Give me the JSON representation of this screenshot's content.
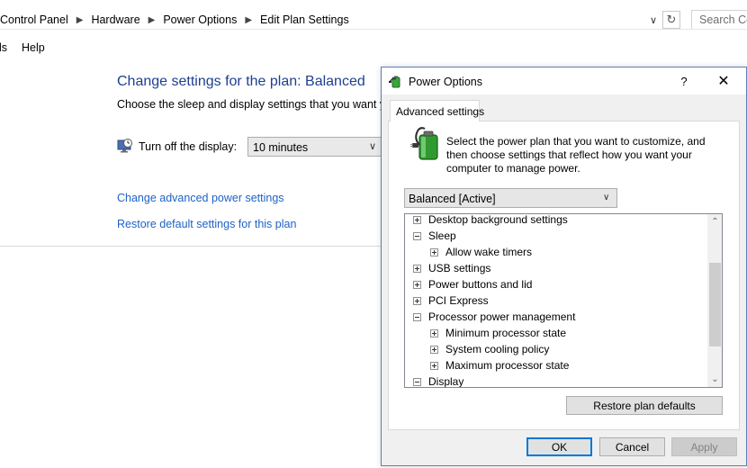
{
  "address_bar": {
    "breadcrumbs": [
      "Control Panel",
      "Hardware",
      "Power Options",
      "Edit Plan Settings"
    ],
    "search_placeholder": "Search Co"
  },
  "menu": {
    "tools_label": "ls",
    "help_label": "Help"
  },
  "plan_page": {
    "title": "Change settings for the plan: Balanced",
    "subtitle": "Choose the sleep and display settings that you want you",
    "display_label": "Turn off the display:",
    "display_value": "10 minutes",
    "advanced_link": "Change advanced power settings",
    "restore_link": "Restore default settings for this plan"
  },
  "dialog": {
    "title": "Power Options",
    "help_glyph": "?",
    "close_glyph": "✕",
    "tab_label": "Advanced settings",
    "description": "Select the power plan that you want to customize, and then choose settings that reflect how you want your computer to manage power.",
    "plan_selected": "Balanced [Active]",
    "tree_items": [
      {
        "label": "Desktop background settings",
        "level": 0,
        "state": "collapsed"
      },
      {
        "label": "Sleep",
        "level": 0,
        "state": "expanded"
      },
      {
        "label": "Allow wake timers",
        "level": 1,
        "state": "collapsed"
      },
      {
        "label": "USB settings",
        "level": 0,
        "state": "collapsed"
      },
      {
        "label": "Power buttons and lid",
        "level": 0,
        "state": "collapsed"
      },
      {
        "label": "PCI Express",
        "level": 0,
        "state": "collapsed"
      },
      {
        "label": "Processor power management",
        "level": 0,
        "state": "expanded"
      },
      {
        "label": "Minimum processor state",
        "level": 1,
        "state": "collapsed"
      },
      {
        "label": "System cooling policy",
        "level": 1,
        "state": "collapsed"
      },
      {
        "label": "Maximum processor state",
        "level": 1,
        "state": "collapsed"
      },
      {
        "label": "Display",
        "level": 0,
        "state": "expanded"
      }
    ],
    "restore_defaults_label": "Restore plan defaults",
    "ok_label": "OK",
    "cancel_label": "Cancel",
    "apply_label": "Apply"
  },
  "colors": {
    "link": "#1e62c6",
    "heading": "#1e3f91",
    "dialog_border": "#5a7fb8",
    "focus": "#0078d7"
  }
}
